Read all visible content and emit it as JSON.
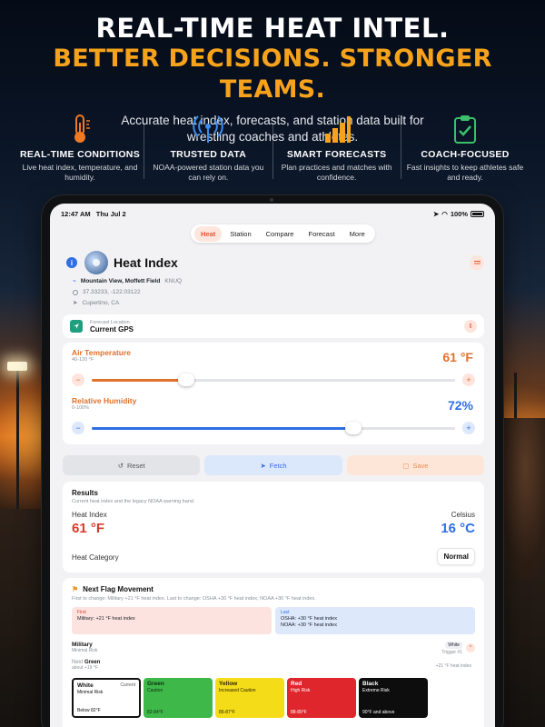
{
  "hero": {
    "title": "REAL-TIME HEAT INTEL.",
    "subtitle": "BETTER DECISIONS. STRONGER TEAMS.",
    "description": "Accurate heat index, forecasts, and station data built for wrestling coaches and athletes."
  },
  "features": [
    {
      "icon": "thermometer-icon",
      "title": "REAL-TIME CONDITIONS",
      "desc": "Live heat index, temperature, and humidity."
    },
    {
      "icon": "broadcast-tower-icon",
      "title": "TRUSTED DATA",
      "desc": "NOAA-powered station data you can rely on."
    },
    {
      "icon": "bar-chart-icon",
      "title": "SMART FORECASTS",
      "desc": "Plan practices and matches with confidence."
    },
    {
      "icon": "clipboard-check-icon",
      "title": "COACH-FOCUSED",
      "desc": "Fast insights to keep athletes safe and ready."
    }
  ],
  "device": {
    "time": "12:47 AM",
    "date": "Thu Jul 2",
    "battery": "100%"
  },
  "tabs": [
    {
      "label": "Heat",
      "active": true
    },
    {
      "label": "Station",
      "active": false
    },
    {
      "label": "Compare",
      "active": false
    },
    {
      "label": "Forecast",
      "active": false
    },
    {
      "label": "More",
      "active": false
    }
  ],
  "app": {
    "title": "Heat Index",
    "station_name": "Mountain View, Moffett Field",
    "station_code": "KNUQ",
    "coords": "37.33233, -122.03122",
    "city": "Cupertino, CA"
  },
  "forecast_location": {
    "label": "Forecast Location",
    "value": "Current GPS"
  },
  "sliders": {
    "air_temp": {
      "title": "Air Temperature",
      "range": "40-120 °F",
      "value": "61 °F",
      "level": 0.26
    },
    "humidity": {
      "title": "Relative Humidity",
      "range": "0-100%",
      "value": "72%",
      "level": 0.72
    }
  },
  "actions": {
    "reset": "Reset",
    "fetch": "Fetch",
    "save": "Save"
  },
  "results": {
    "title": "Results",
    "subtitle": "Current heat index and the legacy NOAA warning band.",
    "heat_index_label": "Heat Index",
    "heat_index_value": "61 °F",
    "celsius_label": "Celsius",
    "celsius_value": "16 °C",
    "category_label": "Heat Category",
    "category_value": "Normal"
  },
  "flag": {
    "title": "Next Flag Movement",
    "subtitle": "First to change: Military +21 °F heat index. Last to change: OSHA +30 °F heat index, NOAA +30 °F heat index.",
    "first_label": "First",
    "first_value": "Military: +21 °F heat index",
    "last_label": "Last",
    "last_value_1": "OSHA: +30 °F heat index",
    "last_value_2": "NOAA: +30 °F heat index",
    "military_title": "Military",
    "military_sub": "Minimal Risk",
    "military_badge": "White",
    "military_trigger": "Trigger #1",
    "next_label": "Next",
    "next_value": "Green",
    "next_about": "about +19 °F",
    "next_right": "+21 °F heat index"
  },
  "levels": [
    {
      "name": "White",
      "risk": "Minimal Risk",
      "range": "Below 82°F",
      "current": "Current",
      "color": "#ffffff",
      "text": "#111111"
    },
    {
      "name": "Green",
      "risk": "Caution",
      "range": "82-84°F",
      "current": "",
      "color": "#3fb84a",
      "text": "#0e2a10"
    },
    {
      "name": "Yellow",
      "risk": "Increased Caution",
      "range": "85-87°F",
      "current": "",
      "color": "#f4dc18",
      "text": "#2a2600"
    },
    {
      "name": "Red",
      "risk": "High Risk",
      "range": "88-89°F",
      "current": "",
      "color": "#e0262d",
      "text": "#ffffff"
    },
    {
      "name": "Black",
      "risk": "Extreme Risk",
      "range": "90°F and above",
      "current": "",
      "color": "#0d0d0d",
      "text": "#ffffff"
    }
  ],
  "colors": {
    "accent_orange": "#e0712a",
    "hero_gold": "#f7a21b",
    "accent_blue": "#2f6fe4",
    "heat_red": "#d93a2b"
  }
}
